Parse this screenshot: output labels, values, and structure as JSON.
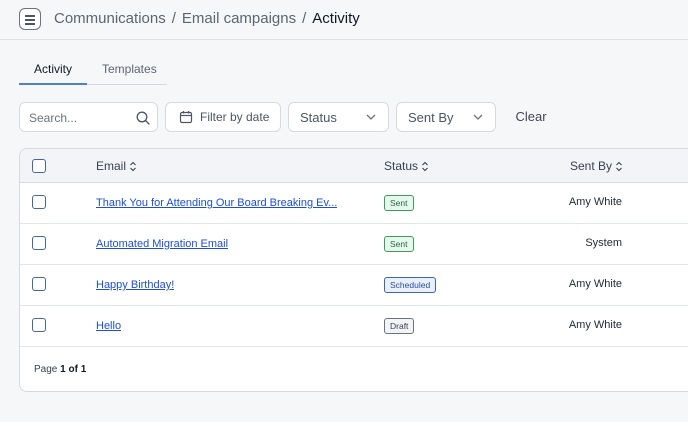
{
  "breadcrumb": {
    "items": [
      "Communications",
      "Email campaigns"
    ],
    "current": "Activity",
    "separator": "/"
  },
  "tabs": [
    {
      "label": "Activity",
      "active": true
    },
    {
      "label": "Templates",
      "active": false
    }
  ],
  "filters": {
    "search_placeholder": "Search...",
    "date_label": "Filter by date",
    "status_label": "Status",
    "sent_by_label": "Sent By",
    "clear_label": "Clear"
  },
  "table": {
    "columns": {
      "email": "Email",
      "status": "Status",
      "sent_by": "Sent By"
    },
    "rows": [
      {
        "email": "Thank You for Attending Our Board Breaking Ev...",
        "status": "Sent",
        "status_kind": "sent",
        "sent_by": "Amy White"
      },
      {
        "email": "Automated Migration Email",
        "status": "Sent",
        "status_kind": "sent",
        "sent_by": "System"
      },
      {
        "email": "Happy Birthday!",
        "status": "Scheduled",
        "status_kind": "scheduled",
        "sent_by": "Amy White"
      },
      {
        "email": "Hello",
        "status": "Draft",
        "status_kind": "draft",
        "sent_by": "Amy White"
      }
    ]
  },
  "pagination": {
    "prefix": "Page",
    "current_total": "1 of 1"
  },
  "icons": {
    "menu": "menu-icon",
    "search": "search-icon",
    "calendar": "calendar-icon",
    "chevron": "chevron-down-icon",
    "sort": "sort-icon"
  },
  "colors": {
    "accent": "#4b82c8",
    "link": "#1d4ed8",
    "sent": "#3e9a5f",
    "scheduled": "#3c66b8",
    "draft": "#6b7280"
  }
}
